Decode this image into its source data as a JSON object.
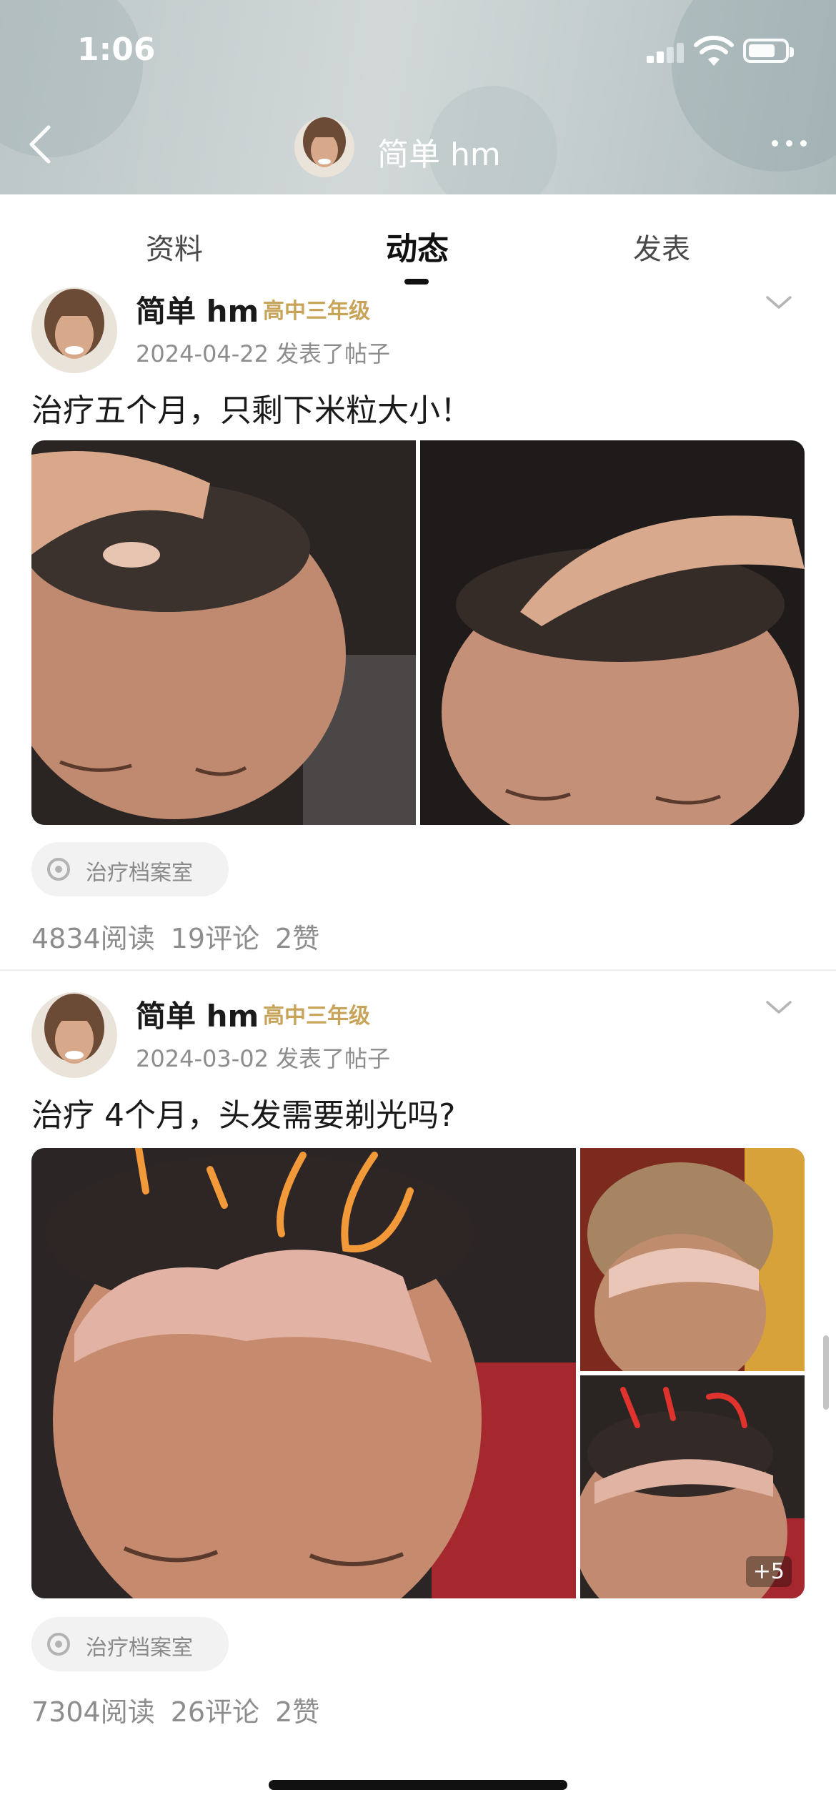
{
  "status_bar": {
    "time": "1:06"
  },
  "nav": {
    "username": "简单 hm"
  },
  "tabs": [
    {
      "label": "资料"
    },
    {
      "label": "动态"
    },
    {
      "label": "发表"
    }
  ],
  "colors": {
    "level_gold": "#c7a45a",
    "meta_gray": "#8d8d8d"
  },
  "posts": [
    {
      "author": "简单 hm",
      "level": "高中三年级",
      "meta": "2024-04-22 发表了帖子",
      "title": "治疗五个月，只剩下米粒大小！",
      "tag": "治疗档案室",
      "reads": "4834阅读",
      "comments": "19评论",
      "likes": "2赞"
    },
    {
      "author": "简单 hm",
      "level": "高中三年级",
      "meta": "2024-03-02 发表了帖子",
      "title": "治疗 4个月，头发需要剃光吗?",
      "tag": "治疗档案室",
      "reads": "7304阅读",
      "comments": "26评论",
      "likes": "2赞",
      "more_images": "+5"
    }
  ]
}
